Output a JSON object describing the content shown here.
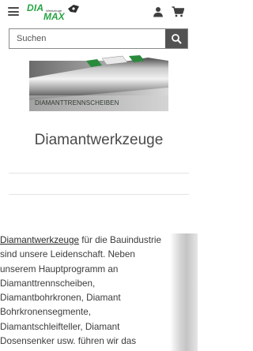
{
  "header": {
    "logo_text_dia": "DIA",
    "logo_text_max": "MAX",
    "logo_subtitle": "Werkzeuge"
  },
  "search": {
    "placeholder": "Suchen"
  },
  "hero": {
    "caption": "DIAMANTTRENNSCHEIBEN"
  },
  "main": {
    "title": "Diamantwerkzeuge"
  },
  "body": {
    "link_text": "Diamantwerkzeuge",
    "line1_rest": " für die Bauindustrie",
    "lines": [
      "sind unsere Leidenschaft. Neben",
      "unserem Hauptprogramm an",
      "Diamanttrennscheiben,",
      "Diamantbohrkronen, Diamant",
      "Bohrkronensegmente,",
      "Diamantschleifteller, Diamant",
      "Dosensenker usw.  führen wir das"
    ]
  },
  "colors": {
    "brand": "#26a344",
    "search_button": "#525252",
    "text": "#3a3a3a"
  }
}
